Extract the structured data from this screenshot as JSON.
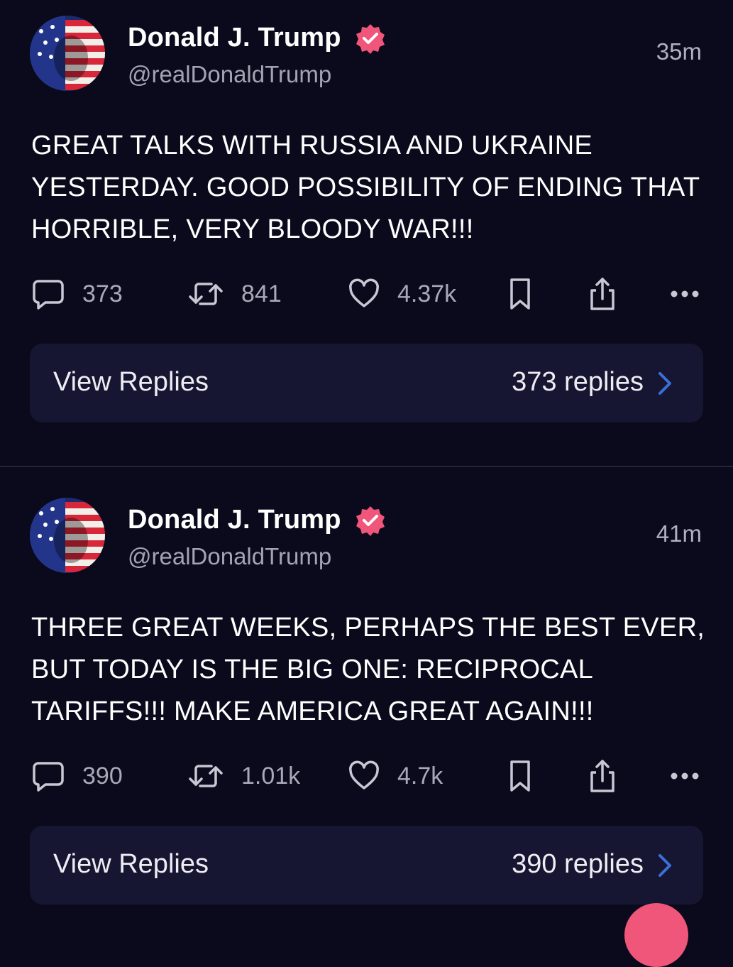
{
  "posts": [
    {
      "author": "Donald J. Trump",
      "handle": "@realDonaldTrump",
      "time": "35m",
      "text": "GREAT TALKS WITH RUSSIA AND UKRAINE YESTERDAY. GOOD POSSIBILITY OF ENDING THAT HORRIBLE, VERY BLOODY WAR!!!",
      "replies": "373",
      "reposts": "841",
      "likes": "4.37k",
      "view_replies_label": "View Replies",
      "replies_label": "373 replies"
    },
    {
      "author": "Donald J. Trump",
      "handle": "@realDonaldTrump",
      "time": "41m",
      "text": "THREE GREAT WEEKS, PERHAPS THE BEST EVER, BUT TODAY IS THE BIG ONE: RECIPROCAL TARIFFS!!! MAKE AMERICA GREAT AGAIN!!!",
      "replies": "390",
      "reposts": "1.01k",
      "likes": "4.7k",
      "view_replies_label": "View Replies",
      "replies_label": "390 replies"
    }
  ],
  "icons": {
    "reply": "reply-icon",
    "repost": "repost-icon",
    "like": "heart-icon",
    "bookmark": "bookmark-icon",
    "share": "share-icon",
    "more": "more-icon",
    "verified": "verified-badge-icon",
    "chevron": "chevron-right-icon"
  },
  "colors": {
    "background": "#0a0a1c",
    "card": "#161633",
    "verified": "#f0557a",
    "accent_chevron": "#3a6fd8",
    "muted_text": "#a8a8b8"
  }
}
